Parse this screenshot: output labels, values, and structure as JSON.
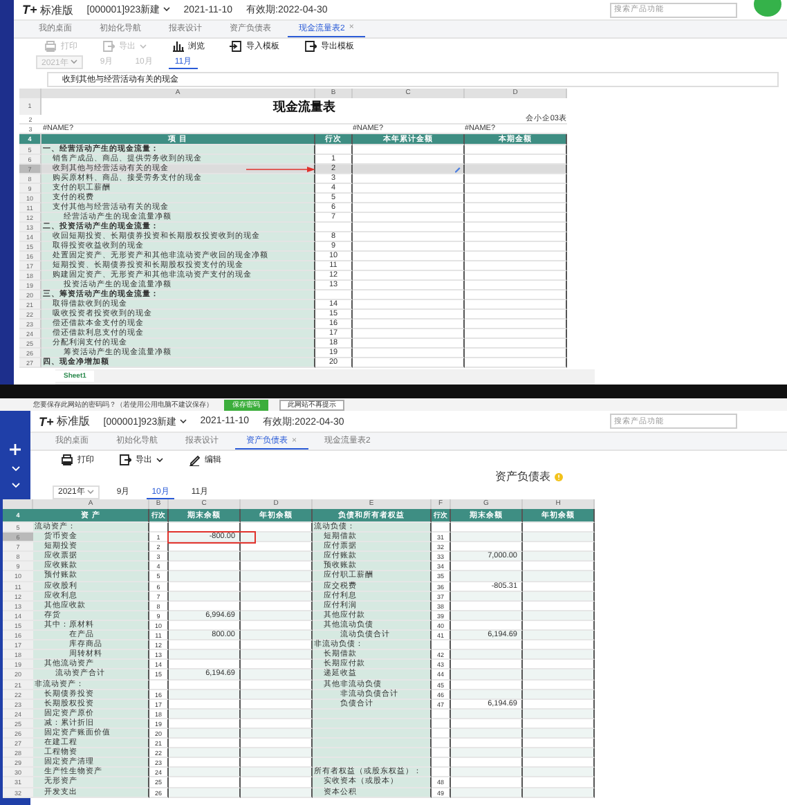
{
  "cash_flow_screen": {
    "header": {
      "logo": "T+",
      "edition": "标准版",
      "account": "[000001]923新建",
      "date": "2021-11-10",
      "expiry": "有效期:2022-04-30",
      "search": {
        "placeholder": "搜索产品功能"
      }
    },
    "tabs": [
      {
        "label": "我的桌面",
        "selected": false
      },
      {
        "label": "初始化导航",
        "selected": false
      },
      {
        "label": "报表设计",
        "selected": false
      },
      {
        "label": "资产负债表",
        "selected": false
      },
      {
        "label": "现金流量表2",
        "selected": true,
        "close": "×"
      }
    ],
    "toolbar": [
      {
        "label": "打印",
        "disabled": true
      },
      {
        "label": "导出",
        "disabled": true,
        "dropdown": true
      },
      {
        "label": "浏览",
        "disabled": false
      },
      {
        "label": "导入模板",
        "disabled": false
      },
      {
        "label": "导出模板",
        "disabled": false
      }
    ],
    "period": {
      "year": "2021年",
      "year_disabled": true,
      "months": [
        {
          "label": "9月",
          "selected": false,
          "disabled": true
        },
        {
          "label": "10月",
          "selected": false,
          "disabled": true
        },
        {
          "label": "11月",
          "selected": true,
          "disabled": false
        }
      ]
    },
    "formula_bar": "收到其他与经营活动有关的现金",
    "sheet": {
      "columns": [
        "A",
        "B",
        "C",
        "D"
      ],
      "rows": [
        {
          "n": "1",
          "kind": "title",
          "selected": false,
          "title": "现金流量表"
        },
        {
          "n": "2",
          "kind": "note",
          "selected": false,
          "d": "会小企03表"
        },
        {
          "n": "3",
          "kind": "plain",
          "selected": false,
          "a": "#NAME?",
          "c": "#NAME?",
          "d": "#NAME?"
        },
        {
          "n": "4",
          "kind": "header",
          "selected": false,
          "a": "项 目",
          "b": "行次",
          "c": "本年累计金额",
          "d": "本期金额"
        },
        {
          "n": "5",
          "kind": "section",
          "selected": false,
          "a": "一、经营活动产生的现金流量："
        },
        {
          "n": "6",
          "kind": "item",
          "selected": false,
          "a": "销售产成品、商品、提供劳务收到的现金",
          "b": "1"
        },
        {
          "n": "7",
          "kind": "item",
          "selected": true,
          "arrow": true,
          "a": "收到其他与经营活动有关的现金",
          "b": "2"
        },
        {
          "n": "8",
          "kind": "item",
          "selected": false,
          "a": "购买原材料、商品、接受劳务支付的现金",
          "b": "3"
        },
        {
          "n": "9",
          "kind": "item",
          "selected": false,
          "a": "支付的职工薪酬",
          "b": "4"
        },
        {
          "n": "10",
          "kind": "item",
          "selected": false,
          "a": "支付的税费",
          "b": "5"
        },
        {
          "n": "11",
          "kind": "item",
          "selected": false,
          "a": "支付其他与经营活动有关的现金",
          "b": "6"
        },
        {
          "n": "12",
          "kind": "total",
          "selected": false,
          "a": "经营活动产生的现金流量净额",
          "b": "7"
        },
        {
          "n": "13",
          "kind": "section",
          "selected": false,
          "a": "二、投资活动产生的现金流量："
        },
        {
          "n": "14",
          "kind": "item",
          "selected": false,
          "a": "收回短期投资、长期债券投资和长期股权投资收到的现金",
          "b": "8"
        },
        {
          "n": "15",
          "kind": "item",
          "selected": false,
          "a": "取得投资收益收到的现金",
          "b": "9"
        },
        {
          "n": "16",
          "kind": "item",
          "selected": false,
          "a": "处置固定资产、无形资产和其他非流动资产收回的现金净额",
          "b": "10"
        },
        {
          "n": "17",
          "kind": "item",
          "selected": false,
          "a": "短期投资、长期债券投资和长期股权投资支付的现金",
          "b": "11"
        },
        {
          "n": "18",
          "kind": "item",
          "selected": false,
          "a": "购建固定资产、无形资产和其他非流动资产支付的现金",
          "b": "12"
        },
        {
          "n": "19",
          "kind": "total",
          "selected": false,
          "a": "投资活动产生的现金流量净额",
          "b": "13"
        },
        {
          "n": "20",
          "kind": "section",
          "selected": false,
          "a": "三、筹资活动产生的现金流量："
        },
        {
          "n": "21",
          "kind": "item",
          "selected": false,
          "a": "取得借款收到的现金",
          "b": "14"
        },
        {
          "n": "22",
          "kind": "item",
          "selected": false,
          "a": "吸收投资者投资收到的现金",
          "b": "15"
        },
        {
          "n": "23",
          "kind": "item",
          "selected": false,
          "a": "偿还借款本金支付的现金",
          "b": "16"
        },
        {
          "n": "24",
          "kind": "item",
          "selected": false,
          "a": "偿还借款利息支付的现金",
          "b": "17"
        },
        {
          "n": "25",
          "kind": "item",
          "selected": false,
          "a": "分配利润支付的现金",
          "b": "18"
        },
        {
          "n": "26",
          "kind": "total",
          "selected": false,
          "a": "筹资活动产生的现金流量净额",
          "b": "19"
        },
        {
          "n": "27",
          "kind": "section",
          "selected": false,
          "a": "四、现金净增加额",
          "b": "20"
        }
      ],
      "sheet_tabs": [
        {
          "label": "Sheet1",
          "selected": true
        }
      ]
    }
  },
  "password_prompt": {
    "message": "您要保存此网站的密码吗？（若使用公用电脑不建议保存）",
    "buttons": [
      {
        "label": "保存密码",
        "kind": "primary"
      },
      {
        "label": "此网站不再提示",
        "kind": "secondary"
      }
    ]
  },
  "balance_sheet_screen": {
    "header": {
      "logo": "T+",
      "edition": "标准版",
      "account": "[000001]923新建",
      "date": "2021-11-10",
      "expiry": "有效期:2022-04-30",
      "search": {
        "placeholder": "搜索产品功能"
      }
    },
    "tabs": [
      {
        "label": "我的桌面",
        "selected": false
      },
      {
        "label": "初始化导航",
        "selected": false
      },
      {
        "label": "报表设计",
        "selected": false
      },
      {
        "label": "资产负债表",
        "selected": true,
        "close": "×"
      },
      {
        "label": "现金流量表2",
        "selected": false
      }
    ],
    "toolbar": [
      {
        "label": "打印",
        "disabled": false
      },
      {
        "label": "导出",
        "disabled": false,
        "dropdown": true
      },
      {
        "label": "编辑",
        "disabled": false
      }
    ],
    "report_title": "资产负债表",
    "period": {
      "year": "2021年",
      "year_disabled": false,
      "months": [
        {
          "label": "9月",
          "selected": false,
          "disabled": false
        },
        {
          "label": "10月",
          "selected": true,
          "disabled": false
        },
        {
          "label": "11月",
          "selected": false,
          "disabled": false
        }
      ]
    },
    "sheet": {
      "columns": [
        "A",
        "B",
        "C",
        "D",
        "E",
        "F",
        "G",
        "H"
      ],
      "rows": [
        {
          "n": "4",
          "selected": false,
          "boxed": false,
          "left": {
            "kind": "header",
            "item": "资 产",
            "line": "行次",
            "end": "期末余额",
            "start": "年初余额"
          },
          "right": {
            "kind": "header",
            "item": "负债和所有者权益",
            "line": "行次",
            "end": "期末余额",
            "start": "年初余额"
          }
        },
        {
          "n": "5",
          "selected": false,
          "boxed": false,
          "left": {
            "kind": "section",
            "item": "流动资产："
          },
          "right": {
            "kind": "section",
            "item": "流动负债："
          }
        },
        {
          "n": "6",
          "selected": true,
          "boxed": true,
          "left": {
            "kind": "item",
            "item": "货币资金",
            "line": "1",
            "end": "-800.00"
          },
          "right": {
            "kind": "item",
            "item": "短期借款",
            "line": "31"
          }
        },
        {
          "n": "7",
          "selected": false,
          "boxed": false,
          "left": {
            "kind": "item",
            "item": "短期投资",
            "line": "2"
          },
          "right": {
            "kind": "item",
            "item": "应付票据",
            "line": "32"
          }
        },
        {
          "n": "8",
          "selected": false,
          "boxed": false,
          "left": {
            "kind": "item",
            "item": "应收票据",
            "line": "3"
          },
          "right": {
            "kind": "item",
            "item": "应付账款",
            "line": "33",
            "end": "7,000.00"
          }
        },
        {
          "n": "9",
          "selected": false,
          "boxed": false,
          "left": {
            "kind": "item",
            "item": "应收账款",
            "line": "4"
          },
          "right": {
            "kind": "item",
            "item": "预收账款",
            "line": "34"
          }
        },
        {
          "n": "10",
          "selected": false,
          "boxed": false,
          "left": {
            "kind": "item",
            "item": "预付账款",
            "line": "5"
          },
          "right": {
            "kind": "item",
            "item": "应付职工薪酬",
            "line": "35"
          }
        },
        {
          "n": "11",
          "selected": false,
          "boxed": false,
          "left": {
            "kind": "item",
            "item": "应收股利",
            "line": "6"
          },
          "right": {
            "kind": "item",
            "item": "应交税费",
            "line": "36",
            "end": "-805.31"
          }
        },
        {
          "n": "12",
          "selected": false,
          "boxed": false,
          "left": {
            "kind": "item",
            "item": "应收利息",
            "line": "7"
          },
          "right": {
            "kind": "item",
            "item": "应付利息",
            "line": "37"
          }
        },
        {
          "n": "13",
          "selected": false,
          "boxed": false,
          "left": {
            "kind": "item",
            "item": "其他应收款",
            "line": "8"
          },
          "right": {
            "kind": "item",
            "item": "应付利润",
            "line": "38"
          }
        },
        {
          "n": "14",
          "selected": false,
          "boxed": false,
          "left": {
            "kind": "item",
            "item": "存货",
            "line": "9",
            "end": "6,994.69"
          },
          "right": {
            "kind": "item",
            "item": "其他应付款",
            "line": "39"
          }
        },
        {
          "n": "15",
          "selected": false,
          "boxed": false,
          "left": {
            "kind": "sub",
            "item": "其中：原材料",
            "line": "10"
          },
          "right": {
            "kind": "item",
            "item": "其他流动负债",
            "line": "40"
          }
        },
        {
          "n": "16",
          "selected": false,
          "boxed": false,
          "left": {
            "kind": "subsub",
            "item": "在产品",
            "line": "11",
            "end": "800.00"
          },
          "right": {
            "kind": "total",
            "item": "流动负债合计",
            "line": "41",
            "end": "6,194.69"
          }
        },
        {
          "n": "17",
          "selected": false,
          "boxed": false,
          "left": {
            "kind": "subsub",
            "item": "库存商品",
            "line": "12"
          },
          "right": {
            "kind": "section",
            "item": "非流动负债："
          }
        },
        {
          "n": "18",
          "selected": false,
          "boxed": false,
          "left": {
            "kind": "subsub",
            "item": "周转材料",
            "line": "13"
          },
          "right": {
            "kind": "item",
            "item": "长期借款",
            "line": "42"
          }
        },
        {
          "n": "19",
          "selected": false,
          "boxed": false,
          "left": {
            "kind": "item",
            "item": "其他流动资产",
            "line": "14"
          },
          "right": {
            "kind": "item",
            "item": "长期应付款",
            "line": "43"
          }
        },
        {
          "n": "20",
          "selected": false,
          "boxed": false,
          "left": {
            "kind": "total",
            "item": "流动资产合计",
            "line": "15",
            "end": "6,194.69"
          },
          "right": {
            "kind": "item",
            "item": "递延收益",
            "line": "44"
          }
        },
        {
          "n": "21",
          "selected": false,
          "boxed": false,
          "left": {
            "kind": "section",
            "item": "非流动资产："
          },
          "right": {
            "kind": "item",
            "item": "其他非流动负债",
            "line": "45"
          }
        },
        {
          "n": "22",
          "selected": false,
          "boxed": false,
          "left": {
            "kind": "item",
            "item": "长期债券投资",
            "line": "16"
          },
          "right": {
            "kind": "total",
            "item": "非流动负债合计",
            "line": "46"
          }
        },
        {
          "n": "23",
          "selected": false,
          "boxed": false,
          "left": {
            "kind": "item",
            "item": "长期股权投资",
            "line": "17"
          },
          "right": {
            "kind": "total",
            "item": "负债合计",
            "line": "47",
            "end": "6,194.69"
          }
        },
        {
          "n": "24",
          "selected": false,
          "boxed": false,
          "left": {
            "kind": "item",
            "item": "固定资产原价",
            "line": "18"
          }
        },
        {
          "n": "25",
          "selected": false,
          "boxed": false,
          "left": {
            "kind": "item",
            "item": "减：累计折旧",
            "line": "19"
          }
        },
        {
          "n": "26",
          "selected": false,
          "boxed": false,
          "left": {
            "kind": "item",
            "item": "固定资产账面价值",
            "line": "20"
          }
        },
        {
          "n": "27",
          "selected": false,
          "boxed": false,
          "left": {
            "kind": "item",
            "item": "在建工程",
            "line": "21"
          }
        },
        {
          "n": "28",
          "selected": false,
          "boxed": false,
          "left": {
            "kind": "item",
            "item": "工程物资",
            "line": "22"
          }
        },
        {
          "n": "29",
          "selected": false,
          "boxed": false,
          "left": {
            "kind": "item",
            "item": "固定资产清理",
            "line": "23"
          }
        },
        {
          "n": "30",
          "selected": false,
          "boxed": false,
          "left": {
            "kind": "item",
            "item": "生产性生物资产",
            "line": "24"
          },
          "right": {
            "kind": "section",
            "item": "所有者权益（或股东权益）："
          }
        },
        {
          "n": "31",
          "selected": false,
          "boxed": false,
          "left": {
            "kind": "item",
            "item": "无形资产",
            "line": "25"
          },
          "right": {
            "kind": "item",
            "item": "实收资本（或股本）",
            "line": "48"
          }
        },
        {
          "n": "32",
          "selected": false,
          "boxed": false,
          "left": {
            "kind": "item",
            "item": "开发支出",
            "line": "26"
          },
          "right": {
            "kind": "item",
            "item": "资本公积",
            "line": "49"
          }
        }
      ]
    }
  }
}
